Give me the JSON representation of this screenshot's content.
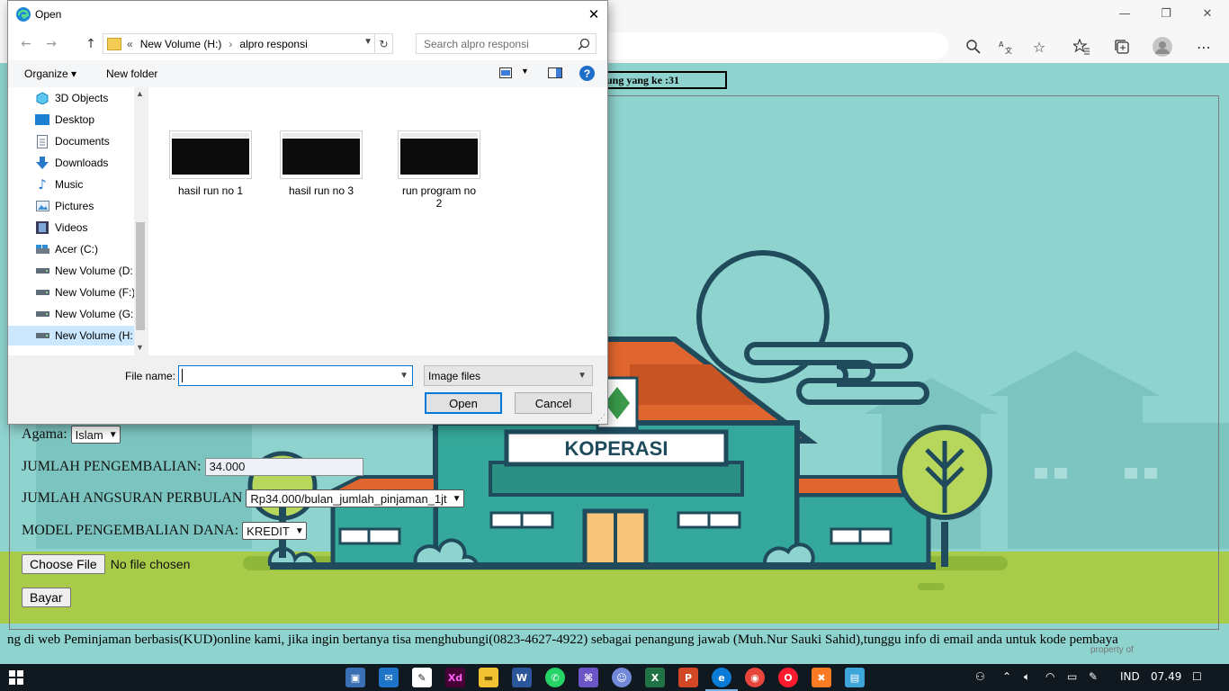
{
  "browser": {
    "window_controls": {
      "minimize": "—",
      "restore": "❐",
      "close": "✕"
    },
    "toolbar_icons": [
      "zoom-icon",
      "translate-icon",
      "favorite-star-icon",
      "favorites-list-icon",
      "collections-icon",
      "profile-icon",
      "more-icon"
    ]
  },
  "dialog": {
    "title": "Open",
    "close_glyph": "✕",
    "nav": {
      "back": "←",
      "forward": "→",
      "up": "↑",
      "refresh": "↻"
    },
    "path": {
      "overflow": "«",
      "segments": [
        "New Volume (H:)",
        "alpro responsi"
      ],
      "separator": "›"
    },
    "search_placeholder": "Search alpro responsi",
    "commands": {
      "organize": "Organize ▾",
      "new_folder": "New folder",
      "help": "?"
    },
    "sidebar": [
      {
        "label": "3D Objects",
        "icon": "3d-objects-icon"
      },
      {
        "label": "Desktop",
        "icon": "desktop-icon"
      },
      {
        "label": "Documents",
        "icon": "documents-icon"
      },
      {
        "label": "Downloads",
        "icon": "downloads-icon"
      },
      {
        "label": "Music",
        "icon": "music-icon"
      },
      {
        "label": "Pictures",
        "icon": "pictures-icon"
      },
      {
        "label": "Videos",
        "icon": "videos-icon"
      },
      {
        "label": "Acer (C:)",
        "icon": "drive-c-icon"
      },
      {
        "label": "New Volume (D:",
        "icon": "drive-icon"
      },
      {
        "label": "New Volume (F:)",
        "icon": "drive-icon"
      },
      {
        "label": "New Volume (G:",
        "icon": "drive-icon"
      },
      {
        "label": "New Volume (H:",
        "icon": "drive-icon",
        "selected": true
      }
    ],
    "files": [
      {
        "name": "hasil run no 1"
      },
      {
        "name": "hasil run no 3"
      },
      {
        "name": "run program no 2"
      }
    ],
    "file_name_label": "File name:",
    "file_name_value": "",
    "file_type": "Image files",
    "open_button": "Open",
    "cancel_button": "Cancel"
  },
  "page": {
    "visitor_counter": "jung yang ke :31",
    "agama_label": "Agama:",
    "agama_value": "Islam",
    "pengembalian_label": "JUMLAH PENGEMBALIAN:",
    "pengembalian_value": "34.000",
    "angsuran_label": "JUMLAH ANGSURAN PERBULAN",
    "angsuran_value": "Rp34.000/bulan_jumlah_pinjaman_1jt",
    "model_label": "MODEL PENGEMBALIAN DANA:",
    "model_value": "KREDIT",
    "choose_file_button": "Choose File",
    "no_file_text": "No file chosen",
    "pay_button": "Bayar",
    "building_sign": "KOPERASI",
    "marquee_text": "ng di web Peminjaman berbasis(KUD)online kami, jika ingin bertanya tisa menghubungi(0823-4627-4922) sebagai penangung jawab (Muh.Nur Sauki Sahid),tunggu info di email anda untuk kode pembaya",
    "watermark": "property of"
  },
  "taskbar": {
    "apps": [
      "store-icon",
      "mail-icon",
      "pen-app-icon",
      "adobe-xd-icon",
      "file-explorer-icon",
      "word-icon",
      "whatsapp-icon",
      "visual-studio-icon",
      "discord-icon",
      "excel-icon",
      "powerpoint-icon",
      "edge-icon",
      "chrome-icon",
      "opera-icon",
      "xampp-icon",
      "app-icon"
    ],
    "language": "IND",
    "time": "07.49"
  },
  "colors": {
    "sky": "#8fd3cf",
    "grass": "#a8cc4a",
    "building": "#34a89a",
    "roof": "#e0662f",
    "outline": "#1f4b5c",
    "taskbar": "#101820"
  }
}
